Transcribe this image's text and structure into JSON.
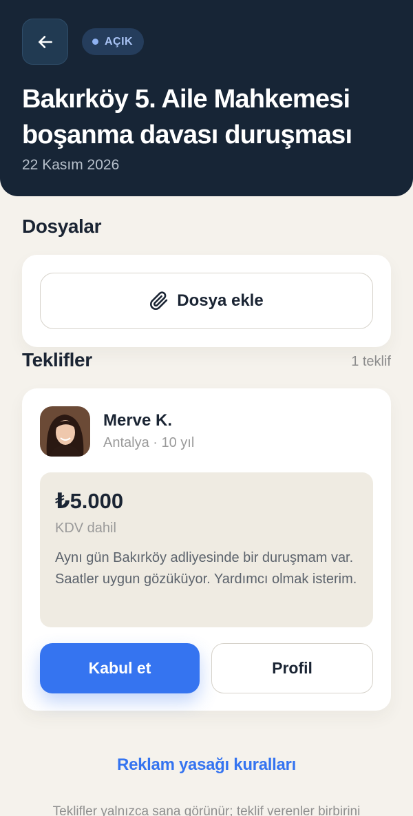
{
  "header": {
    "status": "AÇIK",
    "title": "Bakırköy 5. Aile Mahkemesi boşanma davası duruşması",
    "date": "22 Kasım 2026"
  },
  "files": {
    "title": "Dosyalar",
    "add_label": "Dosya ekle"
  },
  "offers": {
    "title": "Teklifler",
    "count": "1 teklif",
    "items": [
      {
        "name": "Merve K.",
        "meta": "Antalya · 10 yıl",
        "price": "₺5.000",
        "vat": "KDV dahil",
        "message": "Aynı gün Bakırköy adliyesinde bir duruşmam var. Saatler uygun gözüküyor. Yardımcı olmak isterim.",
        "accept_label": "Kabul et",
        "profile_label": "Profil"
      }
    ]
  },
  "footer": {
    "rules_link": "Reklam yasağı kuralları",
    "note": "Teklifler yalnızca sana görünür; teklif verenler birbirini"
  },
  "colors": {
    "header_bg": "#172536",
    "accent": "#3574f0",
    "page_bg": "#f5f2ec"
  },
  "icons": {
    "back": "arrow-left-icon",
    "attach": "paperclip-icon",
    "status": "status-dot-icon"
  }
}
